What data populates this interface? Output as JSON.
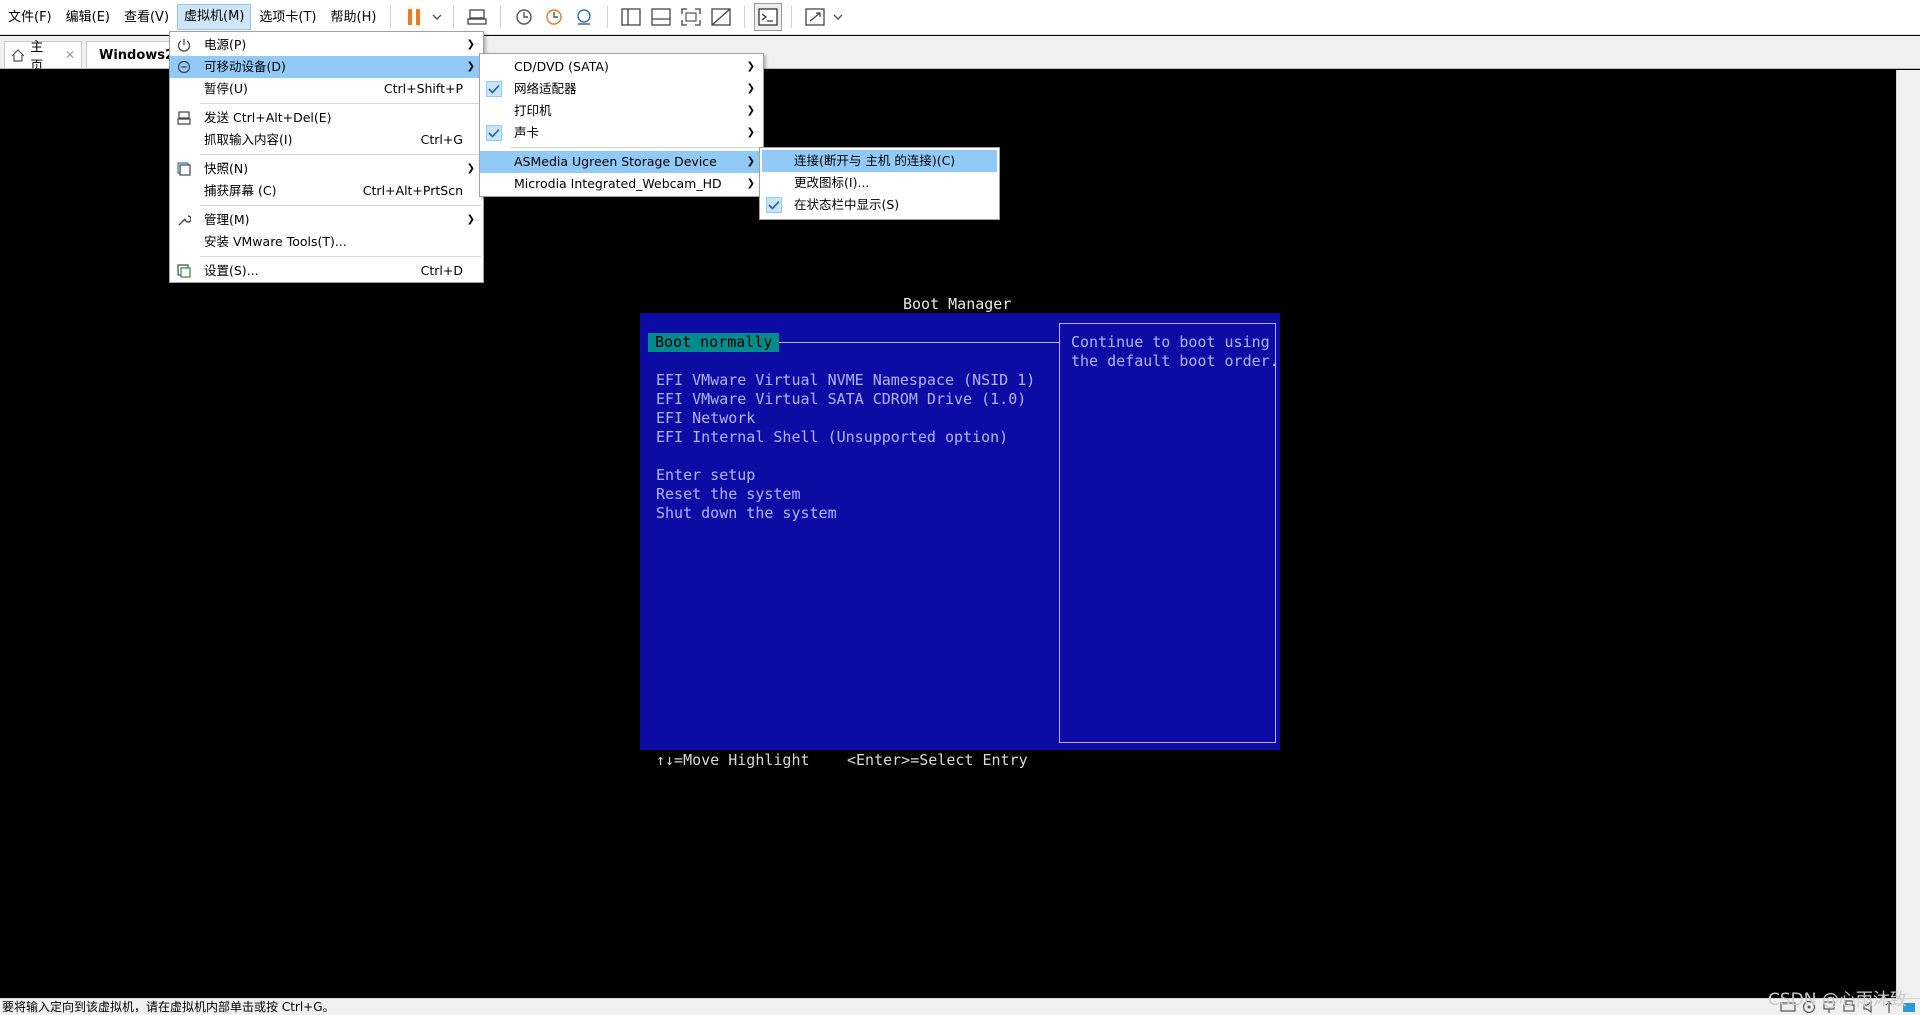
{
  "menubar": {
    "items": [
      "文件(F)",
      "编辑(E)",
      "查看(V)",
      "虚拟机(M)",
      "选项卡(T)",
      "帮助(H)"
    ]
  },
  "tabs": {
    "home": "主页",
    "vm": "Windows2"
  },
  "vm_menu": {
    "items": [
      {
        "label": "电源(P)",
        "shortcut": "",
        "icon": "power-icon"
      },
      {
        "label": "可移动设备(D)",
        "shortcut": "",
        "icon": "removable-device-icon"
      },
      {
        "label": "暂停(U)",
        "shortcut": "Ctrl+Shift+P",
        "icon": ""
      },
      {
        "label": "发送 Ctrl+Alt+Del(E)",
        "shortcut": "",
        "icon": "keyboard-icon"
      },
      {
        "label": "抓取输入内容(I)",
        "shortcut": "Ctrl+G",
        "icon": ""
      },
      {
        "label": "快照(N)",
        "shortcut": "",
        "icon": "snapshot-icon"
      },
      {
        "label": "捕获屏幕 (C)",
        "shortcut": "Ctrl+Alt+PrtScn",
        "icon": ""
      },
      {
        "label": "管理(M)",
        "shortcut": "",
        "icon": "wrench-icon"
      },
      {
        "label": "安装 VMware Tools(T)...",
        "shortcut": "",
        "icon": ""
      },
      {
        "label": "设置(S)...",
        "shortcut": "Ctrl+D",
        "icon": "settings-icon"
      }
    ]
  },
  "devices_menu": {
    "items": [
      {
        "label": "CD/DVD (SATA)",
        "checked": false
      },
      {
        "label": "网络适配器",
        "checked": true
      },
      {
        "label": "打印机",
        "checked": false
      },
      {
        "label": "声卡",
        "checked": true
      },
      {
        "label": "ASMedia Ugreen Storage Device",
        "checked": false
      },
      {
        "label": "Microdia Integrated_Webcam_HD",
        "checked": false
      }
    ]
  },
  "device_submenu": {
    "items": [
      {
        "label": "连接(断开与 主机 的连接)(C)",
        "checked": false
      },
      {
        "label": "更改图标(I)...",
        "checked": false
      },
      {
        "label": "在状态栏中显示(S)",
        "checked": true
      }
    ]
  },
  "boot_manager": {
    "title": "Boot Manager",
    "selected": "Boot normally",
    "entries": [
      "EFI VMware Virtual NVME Namespace (NSID 1)",
      "EFI VMware Virtual SATA CDROM Drive (1.0)",
      "EFI Network",
      "EFI Internal Shell (Unsupported option)"
    ],
    "actions": [
      "Enter setup",
      "Reset the system",
      "Shut down the system"
    ],
    "help_line1": "Continue to boot using",
    "help_line2": "the default boot order.",
    "footer_move": "↑↓=Move Highlight",
    "footer_select": "<Enter>=Select Entry"
  },
  "statusbar": {
    "text": "要将输入定向到该虚拟机，请在虚拟机内部单击或按 Ctrl+G。"
  },
  "watermark": "CSDN @心雨沐致"
}
